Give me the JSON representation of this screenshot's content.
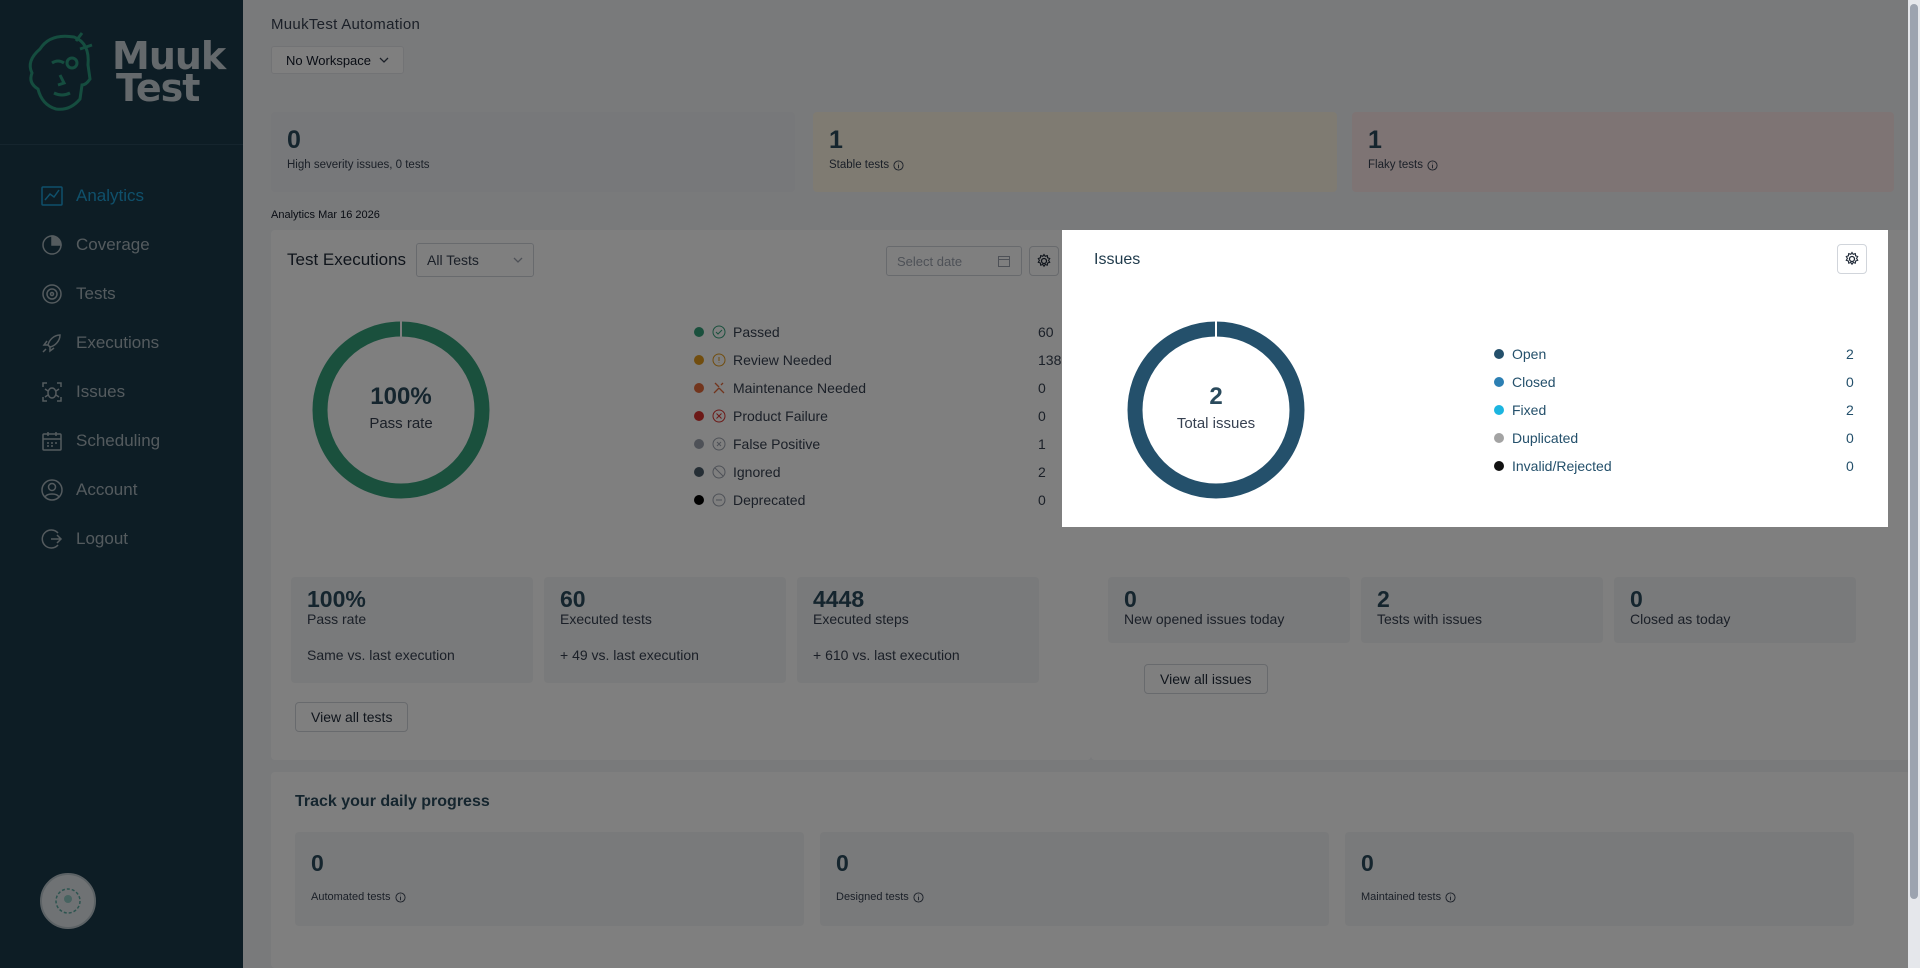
{
  "app": {
    "title": "MuukTest Automation",
    "logo_text_line1": "Muuk",
    "logo_text_line2": "Test",
    "workspace": "No Workspace"
  },
  "sidebar": {
    "items": [
      {
        "label": "Analytics",
        "icon": "chart-icon",
        "active": true
      },
      {
        "label": "Coverage",
        "icon": "coverage-icon"
      },
      {
        "label": "Tests",
        "icon": "tests-icon"
      },
      {
        "label": "Executions",
        "icon": "rocket-icon"
      },
      {
        "label": "Issues",
        "icon": "bug-icon"
      },
      {
        "label": "Scheduling",
        "icon": "calendar-icon"
      },
      {
        "label": "Account",
        "icon": "user-icon"
      },
      {
        "label": "Logout",
        "icon": "logout-icon"
      }
    ]
  },
  "kpis": [
    {
      "value": "0",
      "label": "High severity issues, 0 tests",
      "color": "#eef1f4"
    },
    {
      "value": "1",
      "label": "Stable tests",
      "color": "#fef6e4"
    },
    {
      "value": "1",
      "label": "Flaky tests",
      "color": "#fde8e8"
    }
  ],
  "analytics_date": "Analytics Mar 16 2026",
  "executions": {
    "title": "Test Executions",
    "filter": "All Tests",
    "date_placeholder": "Select date",
    "pass_rate": "100%",
    "pass_rate_label": "Pass rate",
    "legend": [
      {
        "label": "Passed",
        "value": "60",
        "color": "#34a07a"
      },
      {
        "label": "Review Needed",
        "value": "138",
        "color": "#e39a1c"
      },
      {
        "label": "Maintenance Needed",
        "value": "0",
        "color": "#e56a3a"
      },
      {
        "label": "Product Failure",
        "value": "0",
        "color": "#d9322e"
      },
      {
        "label": "False Positive",
        "value": "1",
        "color": "#9ca3af"
      },
      {
        "label": "Ignored",
        "value": "2",
        "color": "#4b5d6b"
      },
      {
        "label": "Deprecated",
        "value": "0",
        "color": "#000000"
      }
    ],
    "stats": [
      {
        "value": "100%",
        "label": "Pass rate",
        "sub": "Same vs. last execution"
      },
      {
        "value": "60",
        "label": "Executed tests",
        "sub": "+ 49 vs. last execution"
      },
      {
        "value": "4448",
        "label": "Executed steps",
        "sub": "+ 610 vs. last execution"
      }
    ],
    "view_all": "View all tests"
  },
  "issues": {
    "title": "Issues",
    "total": "2",
    "total_label": "Total issues",
    "legend": [
      {
        "label": "Open",
        "value": "2",
        "color": "#24506b"
      },
      {
        "label": "Closed",
        "value": "0",
        "color": "#2c7fb3"
      },
      {
        "label": "Fixed",
        "value": "2",
        "color": "#1cb5e0"
      },
      {
        "label": "Duplicated",
        "value": "0",
        "color": "#a3a3a3"
      },
      {
        "label": "Invalid/Rejected",
        "value": "0",
        "color": "#111111"
      }
    ],
    "stats": [
      {
        "value": "0",
        "label": "New opened issues today"
      },
      {
        "value": "2",
        "label": "Tests with issues"
      },
      {
        "value": "0",
        "label": "Closed as today"
      }
    ],
    "view_all": "View all issues"
  },
  "track": {
    "title": "Track your daily progress",
    "cards": [
      {
        "value": "0",
        "label": "Automated tests"
      },
      {
        "value": "0",
        "label": "Designed tests"
      },
      {
        "value": "0",
        "label": "Maintained tests"
      }
    ]
  }
}
